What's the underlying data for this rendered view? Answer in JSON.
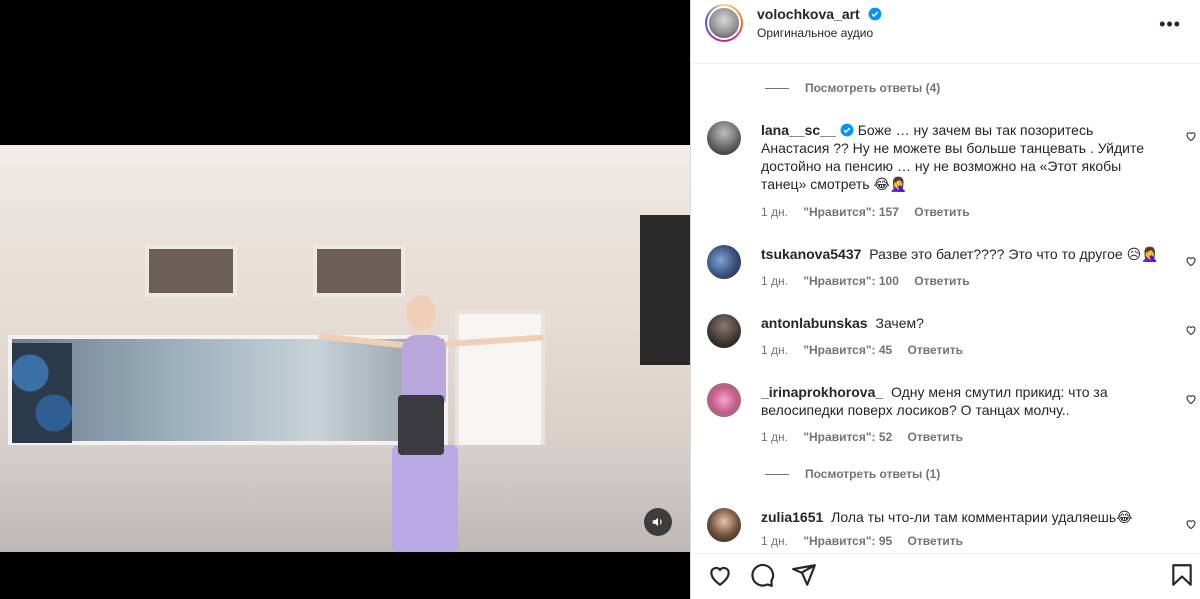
{
  "post": {
    "username": "volochkova_art",
    "audio": "Оригинальное аудио",
    "more_label": "•••"
  },
  "replies_link_1": "Посмотреть ответы (4)",
  "replies_link_2": "Посмотреть ответы (1)",
  "comments": [
    {
      "user": "lana__sc__",
      "verified": true,
      "text": "Боже … ну зачем вы так позоритесь Анастасия ?? Ну не можете вы больше танцевать . Уйдите достойно на пенсию … ну не возможно на «Этот якобы танец» смотреть 😂🤦‍♀️",
      "time": "1 дн.",
      "likes": "\"Нравится\": 157",
      "reply": "Ответить"
    },
    {
      "user": "tsukanova5437",
      "verified": false,
      "text": "Разве это балет???? Это что то другое 😥🤦‍♀️",
      "time": "1 дн.",
      "likes": "\"Нравится\": 100",
      "reply": "Ответить"
    },
    {
      "user": "antonlabunskas",
      "verified": false,
      "text": "Зачем?",
      "time": "1 дн.",
      "likes": "\"Нравится\": 45",
      "reply": "Ответить"
    },
    {
      "user": "_irinaprokhorova_",
      "verified": false,
      "text": "Одну меня смутил прикид: что за велосипедки поверх лосиков? О танцах молчу..",
      "time": "1 дн.",
      "likes": "\"Нравится\": 52",
      "reply": "Ответить"
    },
    {
      "user": "zulia1651",
      "verified": false,
      "text": "Лола ты что-ли там комментарии удаляешь😂",
      "time": "1 дн.",
      "likes": "\"Нравится\": 95",
      "reply": "Ответить"
    }
  ],
  "icons": {
    "verified": "verified-badge-icon",
    "like": "heart-icon",
    "comment": "comment-icon",
    "share": "paper-plane-icon",
    "save": "bookmark-icon",
    "mute": "speaker-icon"
  },
  "colors": {
    "verified": "#0095f6",
    "secondary_text": "#737373"
  }
}
